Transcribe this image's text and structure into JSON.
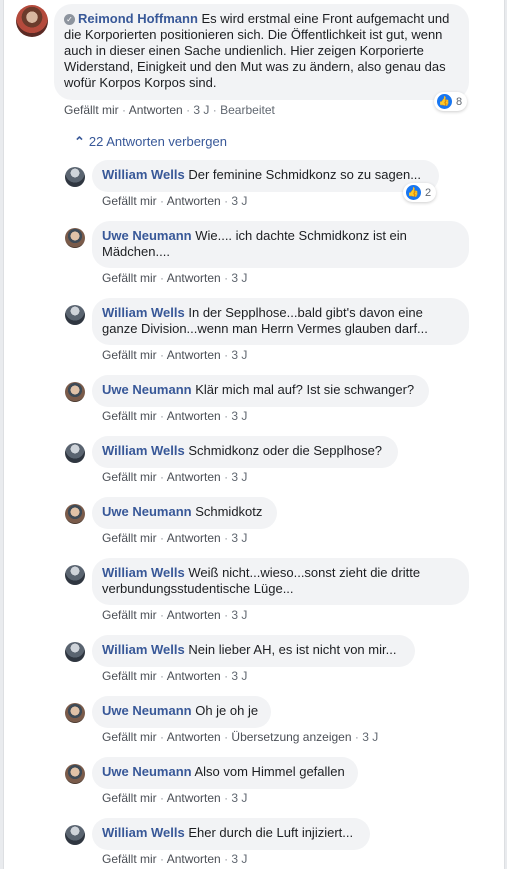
{
  "actions": {
    "like": "Gefällt mir",
    "reply": "Antworten",
    "sep": "·"
  },
  "top_comment": {
    "author": "Reimond Hoffmann",
    "text": "Es wird erstmal eine Front aufgemacht und die Korporierten positionieren sich. Die Öffentlichkeit ist gut, wenn auch in dieser einen Sache undienlich. Hier zeigen Korporierte Widerstand, Einigkeit und den Mut was zu ändern, also genau das wofür Korpos Korpos sind.",
    "time": "3 J",
    "edited": "Bearbeitet",
    "reactions": "8"
  },
  "replies_toggle": {
    "label": "22 Antworten verbergen",
    "icon": "chevron-up-icon"
  },
  "replies": [
    {
      "author": "William Wells",
      "text": "Der feminine Schmidkonz so zu sagen...",
      "time": "3 J",
      "reactions": "2"
    },
    {
      "author": "Uwe Neumann",
      "text": "Wie.... ich dachte Schmidkonz ist ein Mädchen....",
      "time": "3 J"
    },
    {
      "author": "William Wells",
      "text": "In der Sepplhose...bald gibt's davon eine ganze Division...wenn man Herrn Vermes glauben darf...",
      "time": "3 J"
    },
    {
      "author": "Uwe Neumann",
      "text": "Klär mich mal auf? Ist sie schwanger?",
      "time": "3 J"
    },
    {
      "author": "William Wells",
      "text": "Schmidkonz oder die Sepplhose?",
      "time": "3 J"
    },
    {
      "author": "Uwe Neumann",
      "text": "Schmidkotz",
      "time": "3 J"
    },
    {
      "author": "William Wells",
      "text": "Weiß nicht...wieso...sonst zieht die dritte verbundungsstudentische Lüge...",
      "time": "3 J"
    },
    {
      "author": "William Wells",
      "text": "Nein lieber AH, es ist nicht von mir...",
      "time": "3 J"
    },
    {
      "author": "Uwe Neumann",
      "text": "Oh je oh je",
      "time": "3 J",
      "translate": "Übersetzung anzeigen"
    },
    {
      "author": "Uwe Neumann",
      "text": "Also vom Himmel gefallen",
      "time": "3 J"
    },
    {
      "author": "William Wells",
      "text": "Eher durch die Luft injiziert...",
      "time": "3 J"
    }
  ]
}
